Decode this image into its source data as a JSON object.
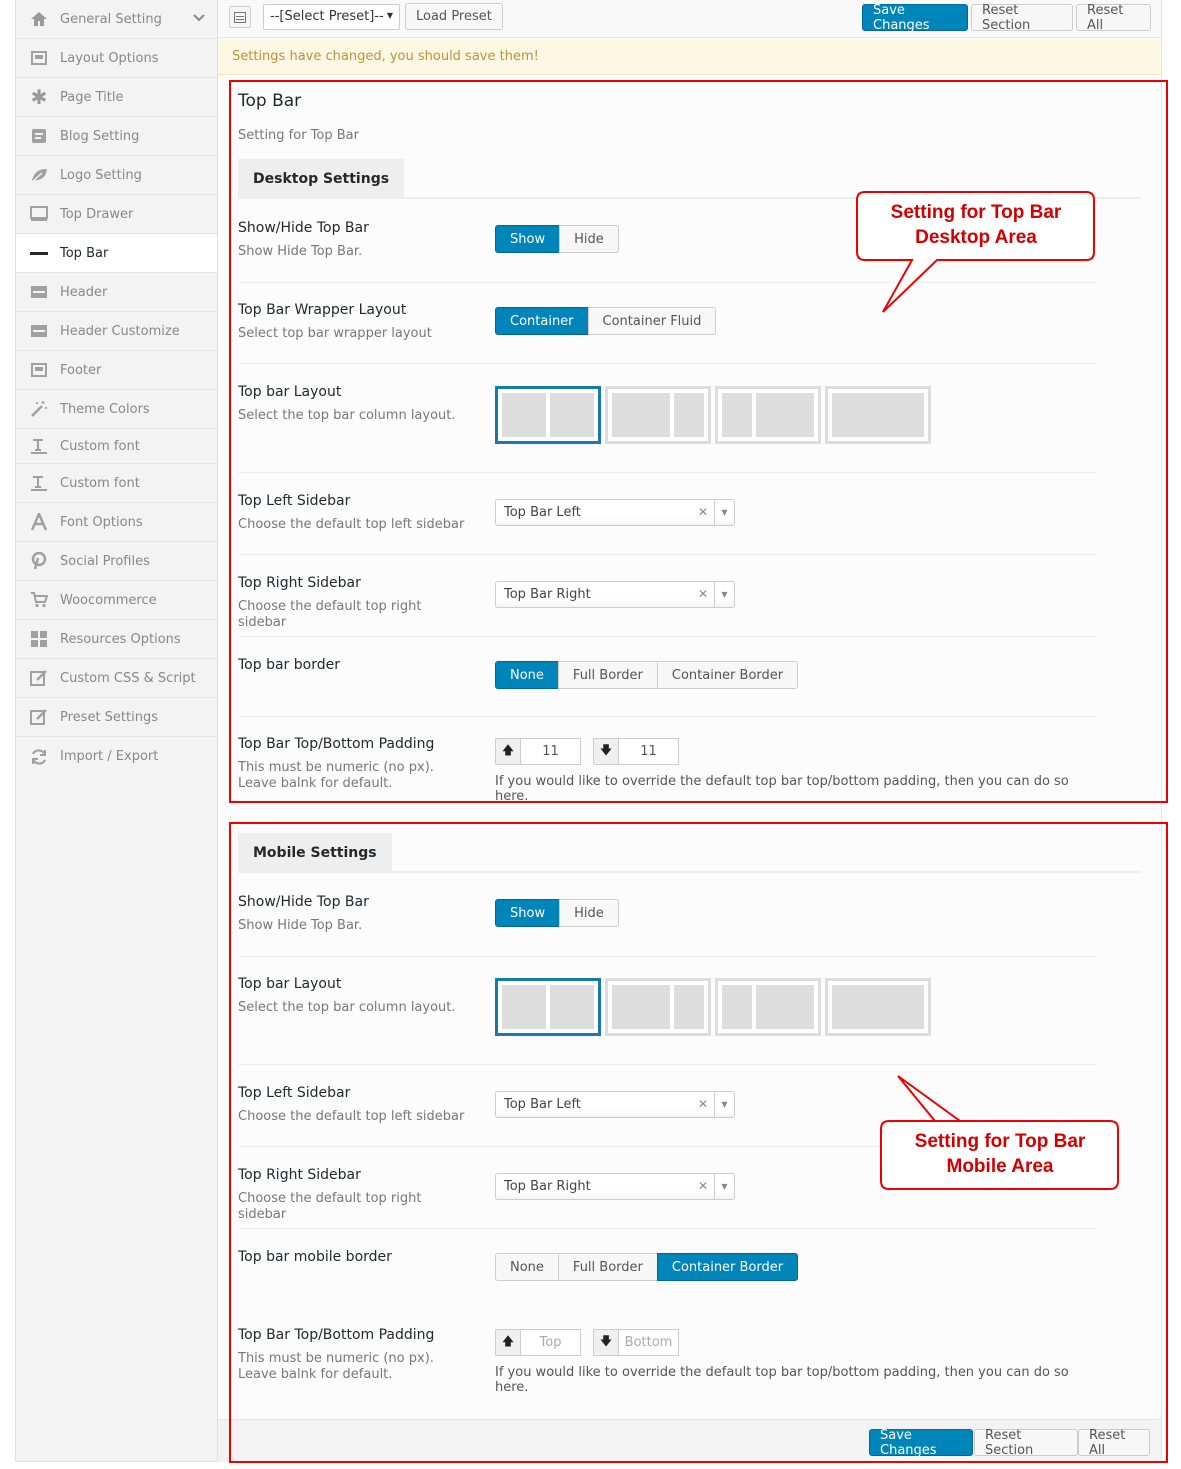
{
  "sidebar": {
    "items": [
      {
        "label": "General Setting",
        "icon": "home-icon"
      },
      {
        "label": "Layout Options",
        "icon": "layout-icon"
      },
      {
        "label": "Page Title",
        "icon": "asterisk-icon"
      },
      {
        "label": "Blog Setting",
        "icon": "blog-icon"
      },
      {
        "label": "Logo Setting",
        "icon": "leaf-icon"
      },
      {
        "label": "Top Drawer",
        "icon": "monitor-icon"
      },
      {
        "label": "Top Bar",
        "icon": "minus-bar-icon"
      },
      {
        "label": "Header",
        "icon": "header-icon"
      },
      {
        "label": "Header Customize",
        "icon": "header-icon"
      },
      {
        "label": "Footer",
        "icon": "footer-icon"
      },
      {
        "label": "Theme Colors",
        "icon": "magic-wand-icon"
      },
      {
        "label": "Custom font",
        "icon": "text-cursor-icon"
      },
      {
        "label": "Custom font",
        "icon": "text-cursor-icon"
      },
      {
        "label": "Font Options",
        "icon": "font-icon"
      },
      {
        "label": "Social Profiles",
        "icon": "pinterest-icon"
      },
      {
        "label": "Woocommerce",
        "icon": "cart-icon"
      },
      {
        "label": "Resources Options",
        "icon": "grid-icon"
      },
      {
        "label": "Custom CSS & Script",
        "icon": "edit-icon"
      },
      {
        "label": "Preset Settings",
        "icon": "edit-icon"
      },
      {
        "label": "Import / Export",
        "icon": "refresh-icon"
      }
    ]
  },
  "toolbar": {
    "preset_select": "--[Select Preset]--",
    "load_preset": "Load Preset",
    "save_changes": "Save Changes",
    "reset_section": "Reset Section",
    "reset_all": "Reset All"
  },
  "notice": "Settings have changed, you should save them!",
  "section": {
    "title": "Top Bar",
    "subtitle": "Setting for Top Bar"
  },
  "desktop": {
    "tab": "Desktop Settings",
    "show_hide": {
      "title": "Show/Hide Top Bar",
      "desc": "Show Hide Top Bar.",
      "options": [
        "Show",
        "Hide"
      ],
      "selected": "Show"
    },
    "wrapper": {
      "title": "Top Bar Wrapper Layout",
      "desc": "Select top bar wrapper layout",
      "options": [
        "Container",
        "Container Fluid"
      ],
      "selected": "Container"
    },
    "layout": {
      "title": "Top bar Layout",
      "desc": "Select the top bar column layout."
    },
    "left_sidebar": {
      "title": "Top Left Sidebar",
      "desc": "Choose the default top left sidebar",
      "value": "Top Bar Left"
    },
    "right_sidebar": {
      "title": "Top Right Sidebar",
      "desc": "Choose the default top right sidebar",
      "value": "Top Bar Right"
    },
    "border": {
      "title": "Top bar border",
      "options": [
        "None",
        "Full Border",
        "Container Border"
      ],
      "selected": "None"
    },
    "padding": {
      "title": "Top Bar Top/Bottom Padding",
      "desc": "This must be numeric (no px). Leave balnk for default.",
      "top": "11",
      "bottom": "11",
      "help": "If you would like to override the default top bar top/bottom padding, then you can do so here."
    }
  },
  "mobile": {
    "tab": "Mobile Settings",
    "show_hide": {
      "title": "Show/Hide Top Bar",
      "desc": "Show Hide Top Bar.",
      "options": [
        "Show",
        "Hide"
      ],
      "selected": "Show"
    },
    "layout": {
      "title": "Top bar Layout",
      "desc": "Select the top bar column layout."
    },
    "left_sidebar": {
      "title": "Top Left Sidebar",
      "desc": "Choose the default top left sidebar",
      "value": "Top Bar Left"
    },
    "right_sidebar": {
      "title": "Top Right Sidebar",
      "desc": "Choose the default top right sidebar",
      "value": "Top Bar Right"
    },
    "border": {
      "title": "Top bar mobile border",
      "options": [
        "None",
        "Full Border",
        "Container Border"
      ],
      "selected": "Container Border"
    },
    "padding": {
      "title": "Top Bar Top/Bottom Padding",
      "desc": "This must be numeric (no px). Leave balnk for default.",
      "top_placeholder": "Top",
      "bottom_placeholder": "Bottom",
      "help": "If you would like to override the default top bar top/bottom padding, then you can do so here."
    }
  },
  "callouts": {
    "desktop": {
      "line1": "Setting for Top Bar",
      "line2": "Desktop Area"
    },
    "mobile": {
      "line1": "Setting for Top Bar",
      "line2": "Mobile Area"
    }
  },
  "colors": {
    "primary": "#0085ba",
    "annotation": "#e00000",
    "notice_text": "#b7933e"
  }
}
